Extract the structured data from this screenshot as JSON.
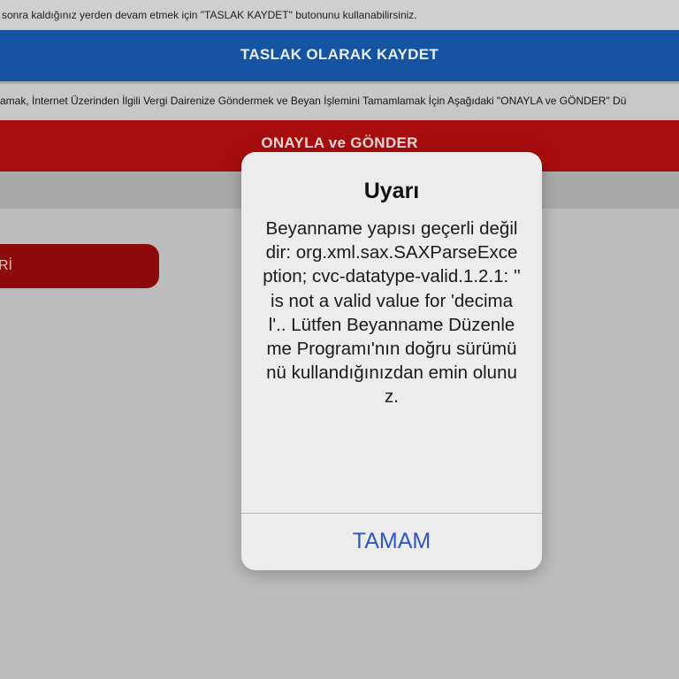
{
  "top_note": "sonra kaldığınız yerden devam etmek için \"TASLAK KAYDET\" butonunu kullanabilirsiniz.",
  "draft_button_label": "TASLAK OLARAK KAYDET",
  "info_text": "amak, İnternet Üzerinden İlgili Vergi Dairenize Göndermek ve Beyan İşlemini Tamamlamak İçin Aşağıdaki \"ONAYLA ve GÖNDER\" Dü",
  "approve_button_label": "ONAYLA ve GÖNDER",
  "red_pill_label": "Rİ",
  "alert": {
    "title": "Uyarı",
    "message": "Beyanname yapısı geçerli değildir: org.xml.sax.SAXParseException; cvc-datatype-valid.1.2.1: '' is not a valid value for 'decimal'.. Lütfen Beyanname Düzenleme Programı'nın doğru sürümünü kullandığınızdan emin olunuz.",
    "ok_label": "TAMAM"
  },
  "colors": {
    "draft_button": "#1553a3",
    "approve_button": "#a80d0d",
    "alert_button_text": "#2e57c4"
  }
}
